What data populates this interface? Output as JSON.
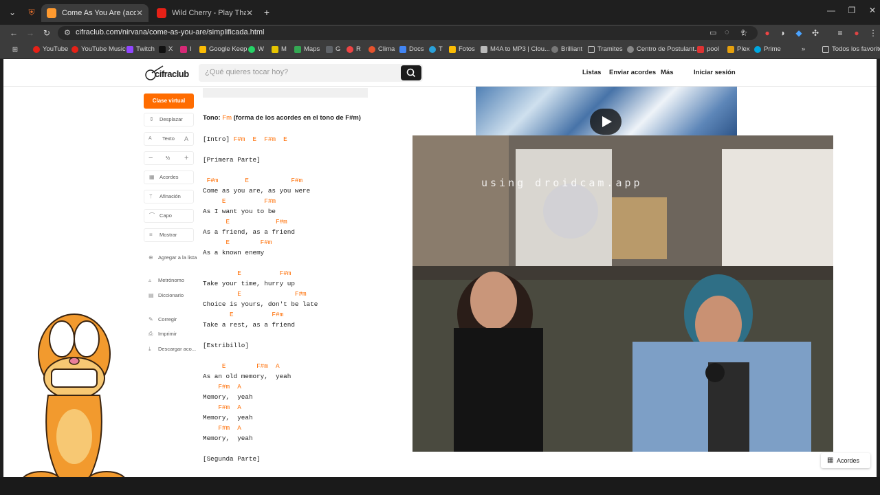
{
  "browser": {
    "tabs": [
      {
        "title": "Come As You Are (acordes) - N",
        "active": true
      },
      {
        "title": "Wild Cherry - Play That Funky M",
        "active": false
      }
    ],
    "new_tab": "+",
    "url": "cifraclub.com/nirvana/come-as-you-are/simplificada.html",
    "bookmarks": [
      "YouTube",
      "YouTube Music",
      "Twitch",
      "X",
      "I",
      "Google Keep",
      "W",
      "M",
      "Maps",
      "G",
      "R",
      "Clima",
      "Docs",
      "T",
      "Fotos",
      "M4A to MP3 | Clou...",
      "Brilliant",
      "Tramites",
      "Centro de Postulant...",
      "pool",
      "Plex",
      "Prime"
    ],
    "bookmarks_more": "»",
    "all_bookmarks": "Todos los favoritos"
  },
  "site": {
    "logo": "cifraclub",
    "search_placeholder": "¿Qué quieres tocar hoy?",
    "nav": {
      "lists": "Listas",
      "send": "Enviar acordes",
      "more": "Más",
      "login": "Iniciar sesión"
    }
  },
  "sidebar": {
    "cta": "Clase virtual",
    "scroll": "Desplazar",
    "text_label": "Texto",
    "text_small": "A",
    "text_big": "A",
    "half": "½",
    "minus": "−",
    "plus": "+",
    "chords": "Acordes",
    "tuning": "Afinación",
    "capo": "Capo",
    "show": "Mostrar",
    "add_list": "Agregar a la lista",
    "metronome": "Metrónomo",
    "dictionary": "Diccionario",
    "correct": "Corregir",
    "print": "Imprimir",
    "download": "Descargar aco..."
  },
  "song": {
    "tone_label": "Tono:",
    "tone_key": "Fm",
    "tone_note": "(forma de los acordes en el tono de F#m)",
    "lines": [
      {
        "type": "mixed",
        "parts": [
          [
            "t",
            "[Intro] "
          ],
          [
            "c",
            "F#m  E  F#m  E"
          ]
        ]
      },
      {
        "type": "gap"
      },
      {
        "type": "text",
        "text": "[Primera Parte]"
      },
      {
        "type": "gap"
      },
      {
        "type": "chord",
        "text": " F#m       E           F#m"
      },
      {
        "type": "text",
        "text": "Come as you are, as you were"
      },
      {
        "type": "chord",
        "text": "     E          F#m"
      },
      {
        "type": "text",
        "text": "As I want you to be"
      },
      {
        "type": "chord",
        "text": "      E            F#m"
      },
      {
        "type": "text",
        "text": "As a friend, as a friend"
      },
      {
        "type": "chord",
        "text": "      E        F#m"
      },
      {
        "type": "text",
        "text": "As a known enemy"
      },
      {
        "type": "gap"
      },
      {
        "type": "chord",
        "text": "         E          F#m"
      },
      {
        "type": "text",
        "text": "Take your time, hurry up"
      },
      {
        "type": "chord",
        "text": "         E              F#m"
      },
      {
        "type": "text",
        "text": "Choice is yours, don't be late"
      },
      {
        "type": "chord",
        "text": "       E          F#m"
      },
      {
        "type": "text",
        "text": "Take a rest, as a friend"
      },
      {
        "type": "gap"
      },
      {
        "type": "text",
        "text": "[Estribillo]"
      },
      {
        "type": "gap"
      },
      {
        "type": "chord",
        "text": "     E        F#m  A"
      },
      {
        "type": "text",
        "text": "As an old memory,  yeah"
      },
      {
        "type": "chord",
        "text": "    F#m  A"
      },
      {
        "type": "text",
        "text": "Memory,  yeah"
      },
      {
        "type": "chord",
        "text": "    F#m  A"
      },
      {
        "type": "text",
        "text": "Memory,  yeah"
      },
      {
        "type": "chord",
        "text": "    F#m  A"
      },
      {
        "type": "text",
        "text": "Memory,  yeah"
      },
      {
        "type": "gap"
      },
      {
        "type": "text",
        "text": "[Segunda Parte]"
      }
    ]
  },
  "webcam": {
    "watermark": "using droidcam.app"
  },
  "floating_button": "Acordes",
  "colors": {
    "accent": "#ff6c00",
    "header_text": "#222222"
  }
}
